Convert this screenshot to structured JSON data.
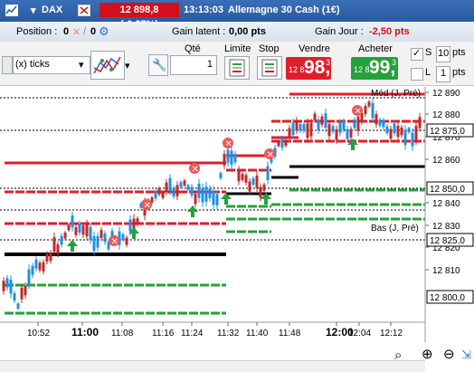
{
  "header": {
    "instrument": "DAX",
    "price_change": "12 898,8 (-0,27%)",
    "time": "13:13:03",
    "market_name": "Allemagne 30 Cash (1€)"
  },
  "position_bar": {
    "position_label": "Position :",
    "position_value": "0",
    "orders_value": "0",
    "latent_label": "Gain latent :",
    "latent_value": "0,00 pts",
    "day_label": "Gain Jour :",
    "day_value": "-2,50 pts"
  },
  "toolbar": {
    "interval": "(x) ticks",
    "qty_label": "Qté",
    "qty_value": "1",
    "limit_label": "Limite",
    "stop_label": "Stop",
    "sell_label": "Vendre",
    "sell_prefix": "12 8",
    "sell_big": "98,",
    "sell_sup": "3",
    "buy_label": "Acheter",
    "buy_prefix": "12 8",
    "buy_big": "99,",
    "buy_sup": "3",
    "s_label": "S",
    "s_value": "10",
    "l_label": "L",
    "l_value": "1",
    "pts_label": "pts"
  },
  "chart": {
    "price_labels": [
      "12 890",
      "12 880",
      "12 870",
      "12 860",
      "12 840",
      "12 830",
      "12 820",
      "12 810"
    ],
    "highlight_labels": [
      "12 875,0",
      "12 850,0",
      "12 825,0",
      "12 800,0"
    ],
    "time_labels": [
      "10:52",
      "11:00",
      "11:08",
      "11:16",
      "11:24",
      "11:32",
      "11:40",
      "11:48",
      "12:00",
      "12:04",
      "12:12"
    ],
    "annotation_high": "Méd (J, Pré)",
    "annotation_low": "Bas (J, Pré)"
  },
  "colors": {
    "sell": "#e01e2a",
    "buy": "#26a03a",
    "candle": "#1f8fe0",
    "titlebar": "#2a5aa0"
  }
}
